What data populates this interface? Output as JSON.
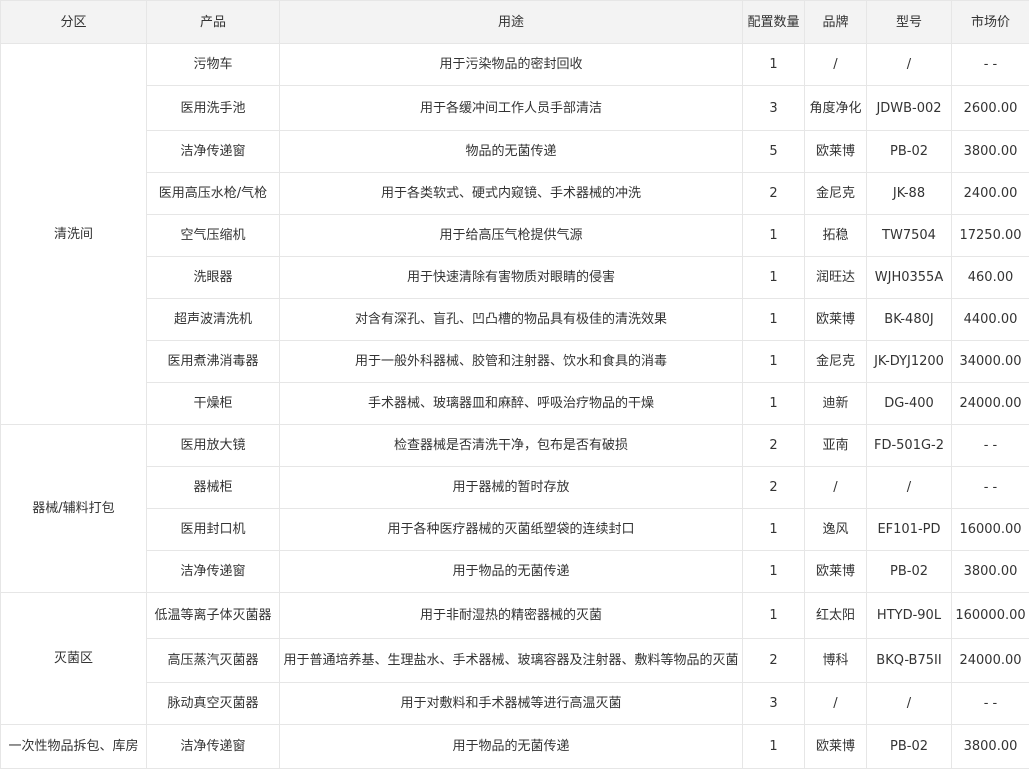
{
  "table": {
    "headers": [
      "分区",
      "产品",
      "用途",
      "配置数量",
      "品牌",
      "型号",
      "市场价"
    ],
    "groups": [
      {
        "zone": "清洗间",
        "rows": [
          {
            "product": "污物车",
            "usage": "用于污染物品的密封回收",
            "qty": "1",
            "brand": "/",
            "model": "/",
            "price": "- -"
          },
          {
            "product": "医用洗手池",
            "usage": "用于各缓冲间工作人员手部清洁",
            "qty": "3",
            "brand": "角度净化",
            "model": "JDWB-002",
            "price": "2600.00"
          },
          {
            "product": "洁净传递窗",
            "usage": "物品的无菌传递",
            "qty": "5",
            "brand": "欧莱博",
            "model": "PB-02",
            "price": "3800.00"
          },
          {
            "product": "医用高压水枪/气枪",
            "usage": "用于各类软式、硬式内窥镜、手术器械的冲洗",
            "qty": "2",
            "brand": "金尼克",
            "model": "JK-88",
            "price": "2400.00"
          },
          {
            "product": "空气压缩机",
            "usage": "用于给高压气枪提供气源",
            "qty": "1",
            "brand": "拓稳",
            "model": "TW7504",
            "price": "17250.00"
          },
          {
            "product": "洗眼器",
            "usage": "用于快速清除有害物质对眼睛的侵害",
            "qty": "1",
            "brand": "润旺达",
            "model": "WJH0355A",
            "price": "460.00"
          },
          {
            "product": "超声波清洗机",
            "usage": "对含有深孔、盲孔、凹凸槽的物品具有极佳的清洗效果",
            "qty": "1",
            "brand": "欧莱博",
            "model": "BK-480J",
            "price": "4400.00"
          },
          {
            "product": "医用煮沸消毒器",
            "usage": "用于一般外科器械、胶管和注射器、饮水和食具的消毒",
            "qty": "1",
            "brand": "金尼克",
            "model": "JK-DYJ1200",
            "price": "34000.00"
          },
          {
            "product": "干燥柜",
            "usage": "手术器械、玻璃器皿和麻醉、呼吸治疗物品的干燥",
            "qty": "1",
            "brand": "迪新",
            "model": "DG-400",
            "price": "24000.00"
          }
        ]
      },
      {
        "zone": "器械/辅料打包",
        "rows": [
          {
            "product": "医用放大镜",
            "usage": "检查器械是否清洗干净，包布是否有破损",
            "qty": "2",
            "brand": "亚南",
            "model": "FD-501G-2",
            "price": "- -"
          },
          {
            "product": "器械柜",
            "usage": "用于器械的暂时存放",
            "qty": "2",
            "brand": "/",
            "model": "/",
            "price": "- -"
          },
          {
            "product": "医用封口机",
            "usage": "用于各种医疗器械的灭菌纸塑袋的连续封口",
            "qty": "1",
            "brand": "逸风",
            "model": "EF101-PD",
            "price": "16000.00"
          },
          {
            "product": "洁净传递窗",
            "usage": "用于物品的无菌传递",
            "qty": "1",
            "brand": "欧莱博",
            "model": "PB-02",
            "price": "3800.00"
          }
        ]
      },
      {
        "zone": "灭菌区",
        "rows": [
          {
            "product": "低温等离子体灭菌器",
            "usage": "用于非耐湿热的精密器械的灭菌",
            "qty": "1",
            "brand": "红太阳",
            "model": "HTYD-90L",
            "price": "160000.00"
          },
          {
            "product": "高压蒸汽灭菌器",
            "usage": "用于普通培养基、生理盐水、手术器械、玻璃容器及注射器、敷料等物品的灭菌",
            "qty": "2",
            "brand": "博科",
            "model": "BKQ-B75II",
            "price": "24000.00"
          },
          {
            "product": "脉动真空灭菌器",
            "usage": "用于对敷料和手术器械等进行高温灭菌",
            "qty": "3",
            "brand": "/",
            "model": "/",
            "price": "- -"
          }
        ]
      },
      {
        "zone": "一次性物品拆包、库房",
        "rows": [
          {
            "product": "洁净传递窗",
            "usage": "用于物品的无菌传递",
            "qty": "1",
            "brand": "欧莱博",
            "model": "PB-02",
            "price": "3800.00"
          }
        ]
      }
    ]
  }
}
